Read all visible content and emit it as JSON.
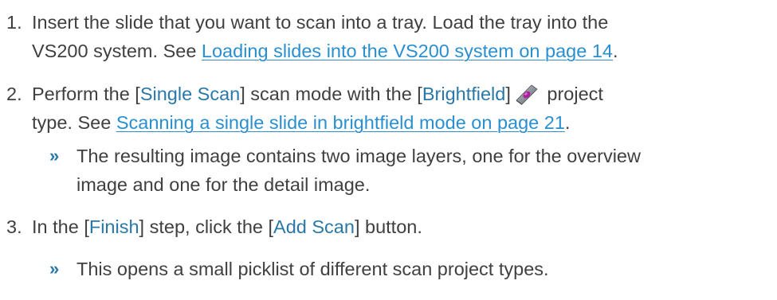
{
  "steps": [
    {
      "number": "1.",
      "line1_text": "Insert the slide that you want to scan into a tray. Load the tray into the",
      "line2_pre": "VS200 system. See ",
      "line2_link": "Loading slides into the VS200 system on page 14",
      "line2_post": "."
    },
    {
      "number": "2.",
      "line1_a": "Perform the [",
      "line1_kw1": "Single Scan",
      "line1_b": "] scan mode with the [",
      "line1_kw2": "Brightfield",
      "line1_c": "]",
      "icon": "brightfield-slide-icon",
      "line1_d": " project",
      "line2_pre": "type. See ",
      "line2_link": "Scanning a single slide in brightfield mode on page 21",
      "line2_post": ".",
      "result_marker": "»",
      "result_line1": "The resulting image contains two image layers, one for the overview",
      "result_line2": "image and one for the detail image."
    },
    {
      "number": "3.",
      "line1_a": "In the [",
      "line1_kw1": "Finish",
      "line1_b": "] step, click the [",
      "line1_kw2": "Add Scan",
      "line1_c": "] button.",
      "result_marker": "»",
      "result_line1": "This opens a small picklist of different scan project types."
    }
  ],
  "colors": {
    "text": "#404040",
    "keyword": "#2a78a8",
    "link": "#2a8fd0"
  }
}
